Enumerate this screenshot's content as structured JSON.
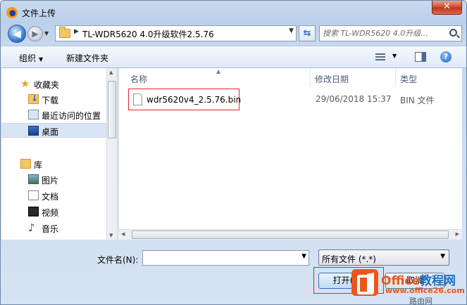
{
  "window": {
    "title": "文件上传",
    "close_label": "✕"
  },
  "address": {
    "path": "TL-WDR5620 4.0升级软件2.5.76",
    "search_placeholder": "搜索 TL-WDR5620 4.0升级..."
  },
  "toolbar": {
    "organize_label": "组织",
    "new_folder_label": "新建文件夹"
  },
  "nav": {
    "favorites": "收藏夹",
    "downloads": "下载",
    "recent": "最近访问的位置",
    "desktop": "桌面",
    "libraries": "库",
    "pictures": "图片",
    "documents": "文档",
    "videos": "视频",
    "music": "音乐"
  },
  "columns": {
    "name": "名称",
    "date": "修改日期",
    "type": "类型"
  },
  "files": [
    {
      "name": "wdr5620v4_2.5.76.bin",
      "date": "29/06/2018 15:37",
      "type": "BIN 文件"
    }
  ],
  "bottom": {
    "filename_label": "文件名(N):",
    "filename_value": "",
    "filter_label": "所有文件 (*.*)",
    "open_label": "打开(O)",
    "cancel_label": "取消"
  },
  "watermark": {
    "title_en": "Office",
    "title_cn": "教程网",
    "url": "www.office26.com",
    "sub": "路由网"
  },
  "colors": {
    "highlight_red": "#e0262a",
    "accent_orange": "#e9571b",
    "accent_blue": "#1b6fc4"
  }
}
